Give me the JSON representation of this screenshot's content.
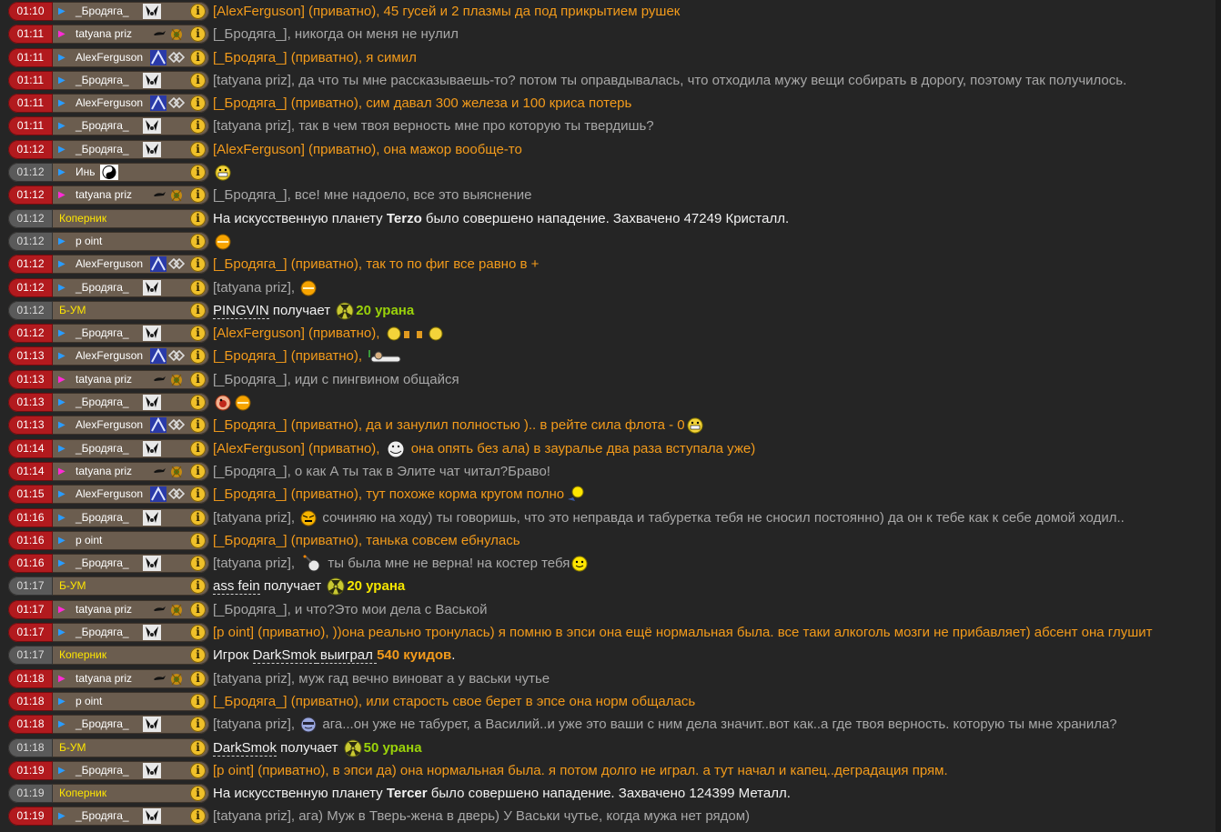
{
  "colors": {
    "background": "#252525",
    "time_user": "#b21a1e",
    "time_system": "#5a5a5a",
    "private_text": "#f39b1b",
    "public_text": "#a8a8a8",
    "system_text": "#f2f2f2",
    "system_name": "#ffe600"
  },
  "messages": [
    {
      "time": "01:10",
      "name": "_Бродяга_",
      "avatar": "bear",
      "arrow": "blue",
      "type": "priv",
      "text": "[AlexFerguson] (приватно), 45 гусей и 2 плазмы да под прикрытием рушек"
    },
    {
      "time": "01:11",
      "name": "tatyana priz",
      "avatar": "tatyana",
      "arrow": "pink",
      "type": "pub",
      "text": "[_Бродяга_], никогда он меня не нулил"
    },
    {
      "time": "01:11",
      "name": "AlexFerguson",
      "avatar": "alex",
      "arrow": "blue",
      "type": "priv",
      "text": "[_Бродяга_] (приватно), я симил"
    },
    {
      "time": "01:11",
      "name": "_Бродяга_",
      "avatar": "bear",
      "arrow": "blue",
      "type": "pub",
      "text": "[tatyana priz], да что ты мне рассказываешь-то? потом ты оправдывалась, что отходила мужу вещи собирать в дорогу, поэтому так получилось."
    },
    {
      "time": "01:11",
      "name": "AlexFerguson",
      "avatar": "alex",
      "arrow": "blue",
      "type": "priv",
      "text": "[_Бродяга_] (приватно), сим давал 300 железа и 100 криса потерь"
    },
    {
      "time": "01:11",
      "name": "_Бродяга_",
      "avatar": "bear",
      "arrow": "blue",
      "type": "pub",
      "text": "[tatyana priz], так в чем твоя верность мне про которую ты твердишь?"
    },
    {
      "time": "01:12",
      "name": "_Бродяга_",
      "avatar": "bear",
      "arrow": "blue",
      "type": "priv",
      "text": "[AlexFerguson] (приватно), она мажор вообще-то"
    },
    {
      "time": "01:12",
      "name": "Инь",
      "avatar": "yinyang",
      "arrow": "blue",
      "type": "pub",
      "text": "",
      "emoji": "grin-yellow",
      "time_style": "sys"
    },
    {
      "time": "01:12",
      "name": "tatyana priz",
      "avatar": "tatyana",
      "arrow": "pink",
      "type": "pub",
      "text": "[_Бродяга_], все! мне надоело, все это выяснение"
    },
    {
      "time": "01:12",
      "name": "Коперник",
      "type": "sys",
      "sys_kind": "attack",
      "planet": "Terzo",
      "sys_pre": "На искусственную планету ",
      "sys_post": " было совершено нападение. Захвачено 47249 Кристалл."
    },
    {
      "time": "01:12",
      "name": "p oint",
      "arrow": "blue",
      "type": "pub",
      "text": "",
      "emoji": "smile-orange",
      "time_style": "sys"
    },
    {
      "time": "01:12",
      "name": "AlexFerguson",
      "avatar": "alex",
      "arrow": "blue",
      "type": "priv",
      "text": "[_Бродяга_] (приватно), так то по фиг все равно в +"
    },
    {
      "time": "01:12",
      "name": "_Бродяга_",
      "avatar": "bear",
      "arrow": "blue",
      "type": "pub",
      "text": "[tatyana priz], ",
      "emoji": "smile-orange"
    },
    {
      "time": "01:12",
      "name": "Б-УМ",
      "type": "sys",
      "sys_kind": "uranium",
      "player": "PINGVIN",
      "gets": " получает ",
      "amount": "20",
      "unit": " урана",
      "amt_color": "g"
    },
    {
      "time": "01:12",
      "name": "_Бродяга_",
      "avatar": "bear",
      "arrow": "blue",
      "type": "priv",
      "text": "[AlexFerguson] (приватно), ",
      "emoji": "cheers"
    },
    {
      "time": "01:13",
      "name": "AlexFerguson",
      "avatar": "alex",
      "arrow": "blue",
      "type": "priv",
      "text": "[_Бродяга_] (приватно), ",
      "emoji": "sleep"
    },
    {
      "time": "01:13",
      "name": "tatyana priz",
      "avatar": "tatyana",
      "arrow": "pink",
      "type": "pub",
      "text": "[_Бродяга_], иди с пингвином общайся"
    },
    {
      "time": "01:13",
      "name": "_Бродяга_",
      "avatar": "bear",
      "arrow": "blue",
      "type": "pub",
      "text": "",
      "emoji": "wink-red"
    },
    {
      "time": "01:13",
      "name": "AlexFerguson",
      "avatar": "alex",
      "arrow": "blue",
      "type": "priv",
      "text": "[_Бродяга_] (приватно), да и занулил полностью ).. в рейте сила флота - 0",
      "emoji_after": "grin-yellow"
    },
    {
      "time": "01:14",
      "name": "_Бродяга_",
      "avatar": "bear",
      "arrow": "blue",
      "type": "priv",
      "text": "[AlexFerguson] (приватно), ",
      "emoji": "troll",
      "text_after": " она опять без ала) в зауралье два раза вступала уже)"
    },
    {
      "time": "01:14",
      "name": "tatyana priz",
      "avatar": "tatyana",
      "arrow": "pink",
      "type": "pub",
      "text": "[_Бродяга_], о как А ты так в Элите чат читал?Браво!"
    },
    {
      "time": "01:15",
      "name": "AlexFerguson",
      "avatar": "alex",
      "arrow": "blue",
      "type": "priv",
      "text": "[_Бродяга_] (приватно), тут похоже корма кругом полно",
      "emoji_after": "wave"
    },
    {
      "time": "01:16",
      "name": "_Бродяга_",
      "avatar": "bear",
      "arrow": "blue",
      "type": "pub",
      "text": "[tatyana priz], ",
      "emoji": "mad",
      "text_after": " сочиняю на ходу) ты говоришь, что это неправда и табуретка тебя не сносил постоянно) да он к тебе как к себе домой ходил.."
    },
    {
      "time": "01:16",
      "name": "p oint",
      "arrow": "blue",
      "type": "priv",
      "text": "[_Бродяга_] (приватно), танька совсем ебнулась"
    },
    {
      "time": "01:16",
      "name": "_Бродяга_",
      "avatar": "bear",
      "arrow": "blue",
      "type": "pub",
      "text": "[tatyana priz], ",
      "emoji": "bomb",
      "text_after": " ты была мне не верна! на костер тебя",
      "emoji_after": "smile-yellow"
    },
    {
      "time": "01:17",
      "name": "Б-УМ",
      "type": "sys",
      "sys_kind": "uranium",
      "player": "ass fein",
      "gets": " получает ",
      "amount": "20",
      "unit": " урана",
      "amt_color": "y"
    },
    {
      "time": "01:17",
      "name": "tatyana priz",
      "avatar": "tatyana",
      "arrow": "pink",
      "type": "pub",
      "text": "[_Бродяга_], и что?Это мои дела с Васькой"
    },
    {
      "time": "01:17",
      "name": "_Бродяга_",
      "avatar": "bear",
      "arrow": "blue",
      "type": "priv",
      "text": "[p oint] (приватно), ))она реально тронулась) я помню в эпси она ещё нормальная была. все таки алкоголь мозги не прибавляет) абсент она глушит"
    },
    {
      "time": "01:17",
      "name": "Коперник",
      "type": "sys",
      "sys_kind": "casino",
      "pre": "Игрок ",
      "player": "DarkSmok",
      "mid": " выиграл ",
      "amount": "540 куидов",
      "post": "."
    },
    {
      "time": "01:18",
      "name": "tatyana priz",
      "avatar": "tatyana",
      "arrow": "pink",
      "type": "pub",
      "text": "[tatyana priz], муж гад вечно виноват а у васьки чутье"
    },
    {
      "time": "01:18",
      "name": "p oint",
      "arrow": "blue",
      "type": "priv",
      "text": "[_Бродяга_] (приватно), или старость свое берет в эпсе она норм общалась"
    },
    {
      "time": "01:18",
      "name": "_Бродяга_",
      "avatar": "bear",
      "arrow": "blue",
      "type": "pub",
      "text": "[tatyana priz], ",
      "emoji": "cool",
      "text_after": " ага...он уже не табурет, а Василий..и уже это ваши с ним дела значит..вот как..а где твоя верность. которую ты мне хранила?"
    },
    {
      "time": "01:18",
      "name": "Б-УМ",
      "type": "sys",
      "sys_kind": "uranium",
      "player": "DarkSmok",
      "gets": " получает ",
      "amount": "50",
      "unit": " урана",
      "amt_color": "g"
    },
    {
      "time": "01:19",
      "name": "_Бродяга_",
      "avatar": "bear",
      "arrow": "blue",
      "type": "priv",
      "text": "[p oint] (приватно), в эпси да) она нормальная была. я потом долго не играл. а тут начал и капец..деградация прям."
    },
    {
      "time": "01:19",
      "name": "Коперник",
      "type": "sys",
      "sys_kind": "attack",
      "planet": "Tercer",
      "sys_pre": "На искусственную планету ",
      "sys_post": " было совершено нападение. Захвачено 124399 Металл."
    },
    {
      "time": "01:19",
      "name": "_Бродяга_",
      "avatar": "bear",
      "arrow": "blue",
      "type": "pub",
      "text": "[tatyana priz], ага) Муж в Тверь-жена в дверь) У Васьки чутье, когда мужа нет рядом)"
    }
  ]
}
